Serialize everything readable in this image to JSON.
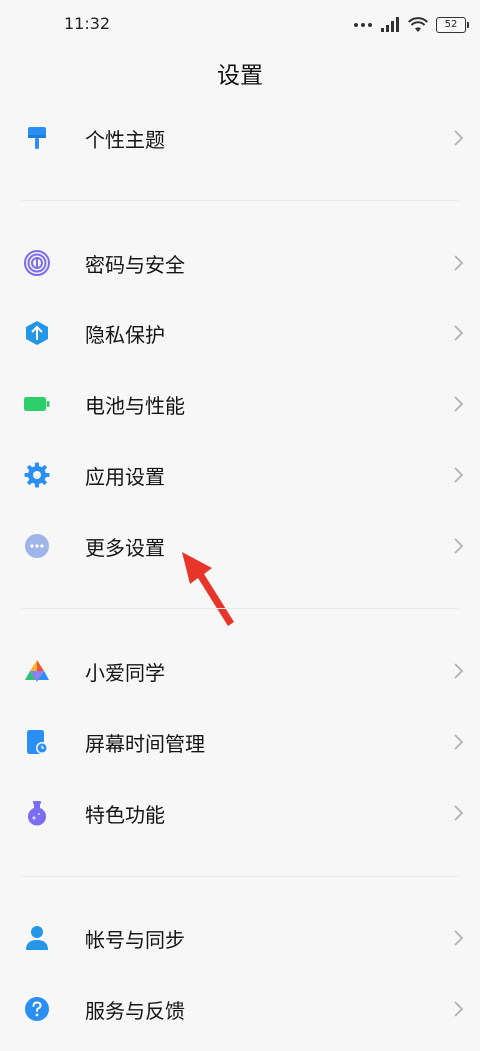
{
  "status_bar": {
    "time": "11:32",
    "battery": "52"
  },
  "title": "设置",
  "groups": [
    {
      "items": [
        {
          "label": "个性主题",
          "icon": "theme-brush-icon",
          "color": "#2a8ff4"
        }
      ]
    },
    {
      "items": [
        {
          "label": "密码与安全",
          "icon": "fingerprint-icon",
          "color": "#7b6cf0"
        },
        {
          "label": "隐私保护",
          "icon": "privacy-shield-icon",
          "color": "#2496e8"
        },
        {
          "label": "电池与性能",
          "icon": "battery-icon",
          "color": "#2ecf6a"
        },
        {
          "label": "应用设置",
          "icon": "gear-icon",
          "color": "#2a8ff4"
        },
        {
          "label": "更多设置",
          "icon": "more-dots-icon",
          "color": "#9fb4e8"
        }
      ]
    },
    {
      "items": [
        {
          "label": "小爱同学",
          "icon": "xiaoai-icon",
          "color": "#f0503c"
        },
        {
          "label": "屏幕时间管理",
          "icon": "screen-time-icon",
          "color": "#2a8ff4"
        },
        {
          "label": "特色功能",
          "icon": "flask-icon",
          "color": "#7b6cf0"
        }
      ]
    },
    {
      "items": [
        {
          "label": "帐号与同步",
          "icon": "account-icon",
          "color": "#2496e8"
        },
        {
          "label": "服务与反馈",
          "icon": "help-icon",
          "color": "#2a8ff4"
        }
      ]
    }
  ],
  "annotation": {
    "color": "#e8352a"
  }
}
